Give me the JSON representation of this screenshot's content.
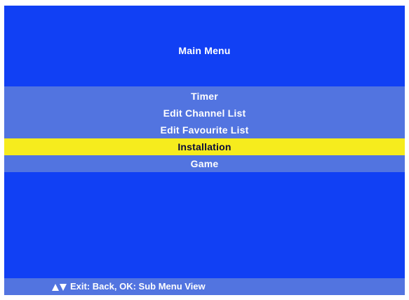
{
  "screen": {
    "title": "Main Menu"
  },
  "menu": {
    "items": [
      {
        "label": "Timer"
      },
      {
        "label": "Edit Channel List"
      },
      {
        "label": "Edit Favourite List"
      },
      {
        "label": "Installation"
      },
      {
        "label": "Game"
      }
    ],
    "selected_index": 3
  },
  "footer": {
    "icons": [
      "up-arrow-icon",
      "down-arrow-icon"
    ],
    "hint": "Exit: Back, OK: Sub Menu View"
  },
  "colors": {
    "background": "#1140f4",
    "menu_band": "#5274e0",
    "selection": "#f6ec1d"
  }
}
